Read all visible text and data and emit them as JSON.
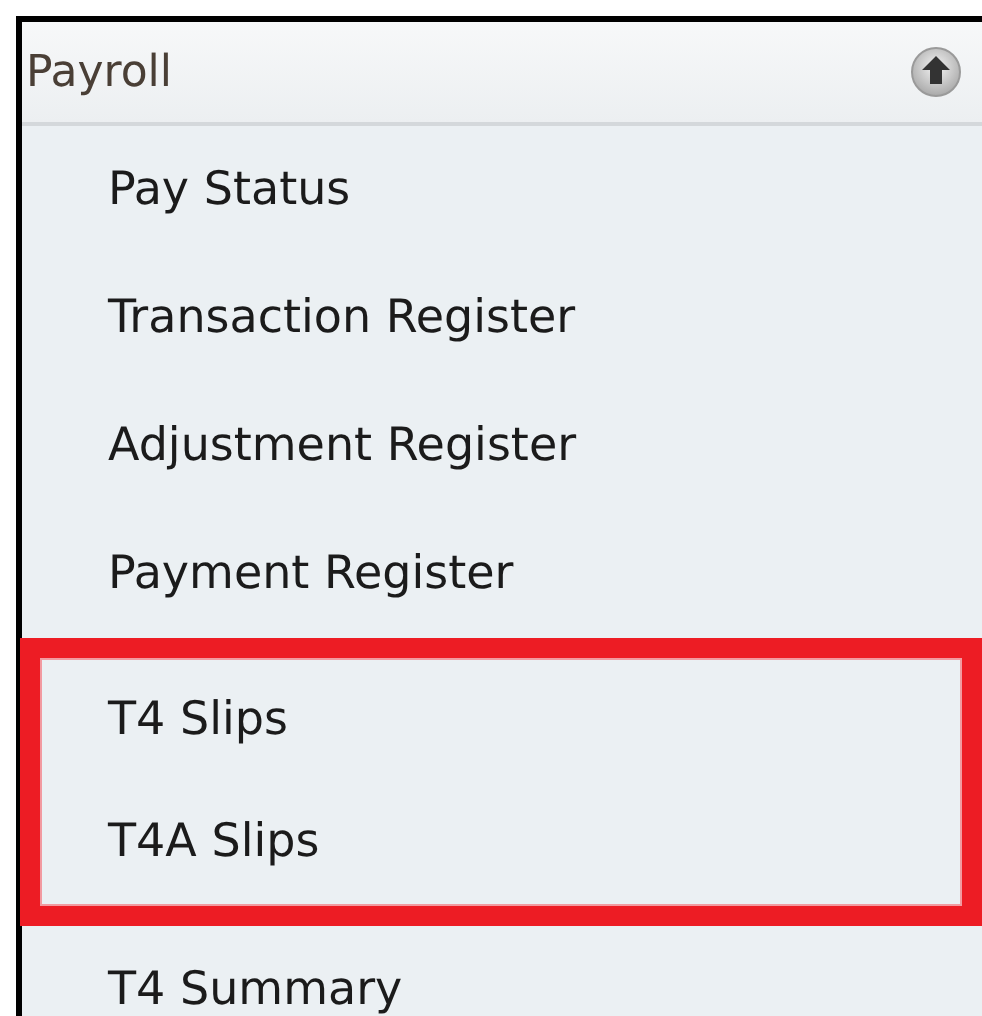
{
  "panel": {
    "title": "Payroll",
    "expanded": true,
    "items": [
      {
        "label": "Pay Status",
        "highlighted": false
      },
      {
        "label": "Transaction Register",
        "highlighted": false
      },
      {
        "label": "Adjustment Register",
        "highlighted": false
      },
      {
        "label": "Payment Register",
        "highlighted": false
      },
      {
        "label": "T4 Slips",
        "highlighted": true
      },
      {
        "label": "T4A Slips",
        "highlighted": true
      },
      {
        "label": "T4 Summary",
        "highlighted": false
      }
    ]
  }
}
